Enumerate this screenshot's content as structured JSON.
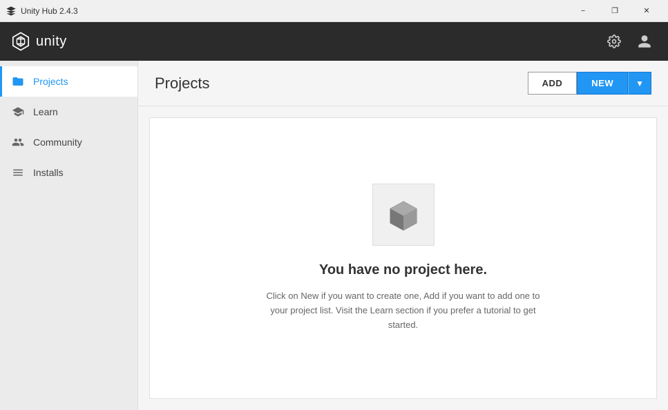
{
  "titlebar": {
    "title": "Unity Hub 2.4.3",
    "minimize_label": "−",
    "restore_label": "❐",
    "close_label": "✕"
  },
  "header": {
    "logo_text": "unity",
    "gear_icon": "⚙",
    "account_icon": "👤"
  },
  "sidebar": {
    "items": [
      {
        "id": "projects",
        "label": "Projects",
        "active": true
      },
      {
        "id": "learn",
        "label": "Learn",
        "active": false
      },
      {
        "id": "community",
        "label": "Community",
        "active": false
      },
      {
        "id": "installs",
        "label": "Installs",
        "active": false
      }
    ]
  },
  "main": {
    "title": "Projects",
    "add_label": "ADD",
    "new_label": "NEW",
    "empty_title": "You have no project here.",
    "empty_description": "Click on New if you want to create one, Add if you want to add one to your project list. Visit the Learn section if you prefer a tutorial to get started."
  }
}
